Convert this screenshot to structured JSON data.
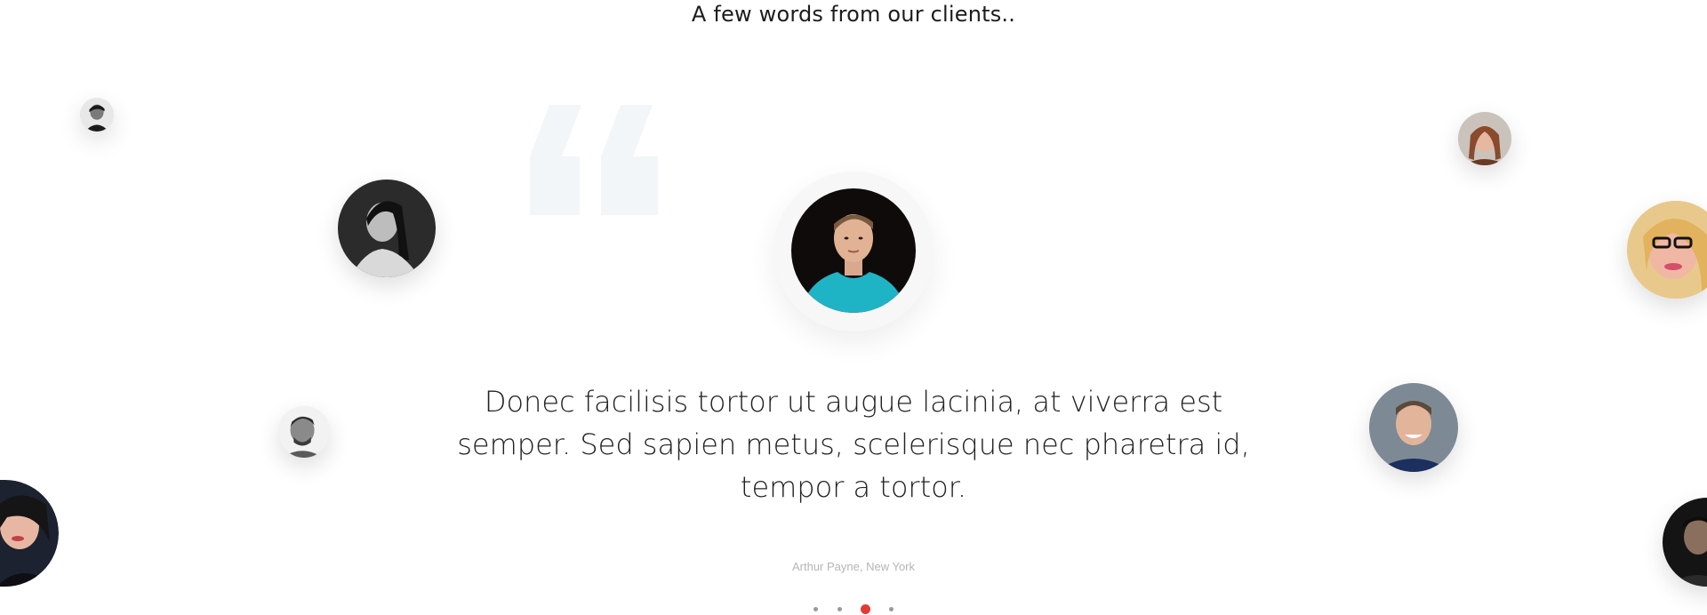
{
  "section": {
    "title": "A few words from our clients.."
  },
  "testimonial": {
    "quote": "Donec facilisis tortor ut augue lacinia, at viverra est semper. Sed sapien metus, scelerisque nec pharetra id, tempor a tortor.",
    "author": "Arthur Payne, New York"
  },
  "pagination": {
    "total": 4,
    "active_index": 2
  },
  "colors": {
    "accent": "#e53935",
    "dot_inactive": "#9a9a9a",
    "quote_mark": "#f3f6f9",
    "author_text": "#b5b5b5"
  },
  "icons": {
    "quote": "quote-open-icon"
  }
}
